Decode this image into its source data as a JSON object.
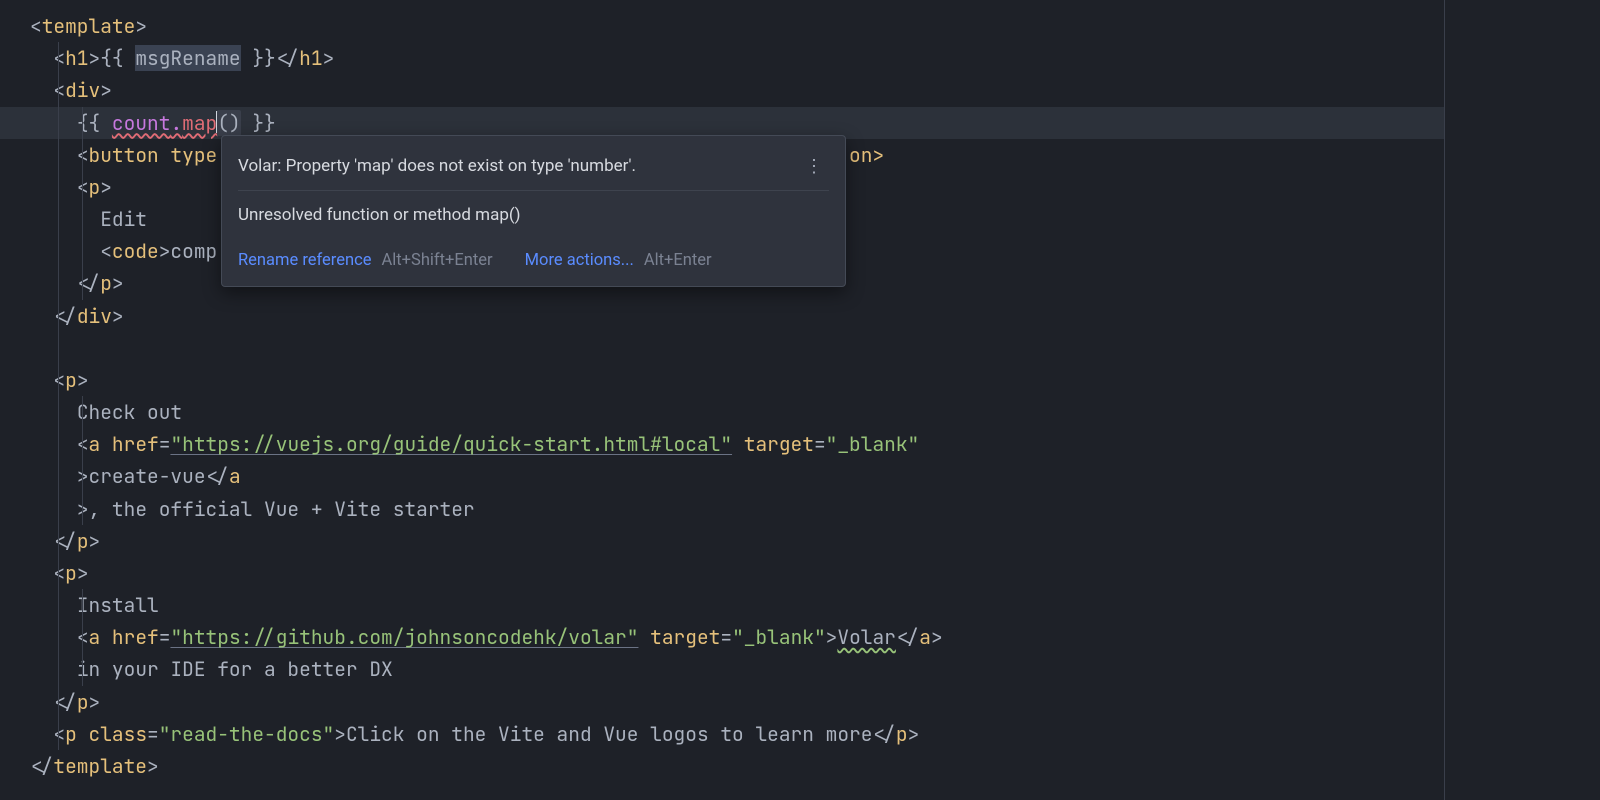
{
  "code": {
    "templateOpen": "template",
    "h1": {
      "tag": "h1",
      "expr": "msgRename"
    },
    "div": "div",
    "countExpr": {
      "obj": "count",
      "dot": ".",
      "method": "map",
      "call": "()"
    },
    "button": {
      "tag": "button",
      "attr": "type",
      "tailVisible": "on>"
    },
    "p": "p",
    "editText": "Edit",
    "code": {
      "tag": "code",
      "textStart": "comp"
    },
    "checkOut": "Check out",
    "a": "a",
    "href": "href",
    "target": "target",
    "blank": "\"_blank\"",
    "vueUrl": "\"https://vuejs.org/guide/quick-start.html#local\"",
    "createVue": "create-vue",
    "createVueTail": ", the official Vue + Vite starter",
    "install": "Install",
    "volarUrl": "\"https://github.com/johnsoncodehk/volar\"",
    "volar": "Volar",
    "ideText": "in your IDE for a better DX",
    "pClassAttr": "class",
    "pClassVal": "\"read-the-docs\"",
    "clickText": "Click on the Vite and Vue logos to learn more"
  },
  "tooltip": {
    "primary": "Volar: Property 'map' does not exist on type 'number'.",
    "secondary": "Unresolved function or method map()",
    "renameLabel": "Rename reference",
    "renameShortcut": "Alt+Shift+Enter",
    "moreLabel": "More actions...",
    "moreShortcut": "Alt+Enter"
  }
}
